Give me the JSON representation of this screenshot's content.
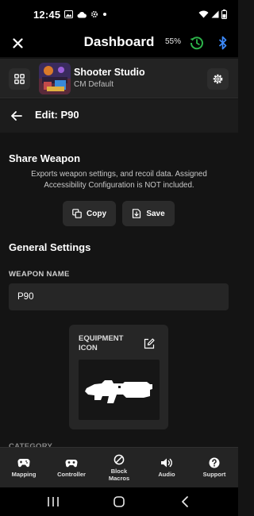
{
  "status_bar": {
    "time": "12:45",
    "icons": [
      "image-icon",
      "cloud-icon",
      "gear-icon",
      "dot-icon",
      "wifi-icon",
      "signal-icon",
      "battery-icon"
    ]
  },
  "header": {
    "title": "Dashboard",
    "battery_percent": "55%"
  },
  "profile": {
    "name": "Shooter Studio",
    "config": "CM Default"
  },
  "edit": {
    "title": "Edit: P90"
  },
  "share": {
    "title": "Share Weapon",
    "description": "Exports weapon settings, and recoil data. Assigned Accessibility Configuration is NOT included.",
    "copy_label": "Copy",
    "save_label": "Save"
  },
  "general": {
    "title": "General Settings",
    "weapon_name_label": "WEAPON NAME",
    "weapon_name_value": "P90",
    "equipment_icon_label": "EQUIPMENT ICON",
    "category_label": "CATEGORY"
  },
  "bottom_nav": [
    {
      "label": "Mapping",
      "icon": "gamepad-icon"
    },
    {
      "label": "Controller",
      "icon": "controller-icon"
    },
    {
      "label": "Block\nMacros",
      "icon": "block-icon"
    },
    {
      "label": "Audio",
      "icon": "speaker-icon"
    },
    {
      "label": "Support",
      "icon": "help-icon"
    }
  ],
  "colors": {
    "accent_green": "#2db44a",
    "bluetooth_blue": "#3d8bfd",
    "background": "#141414",
    "surface": "#262626"
  }
}
